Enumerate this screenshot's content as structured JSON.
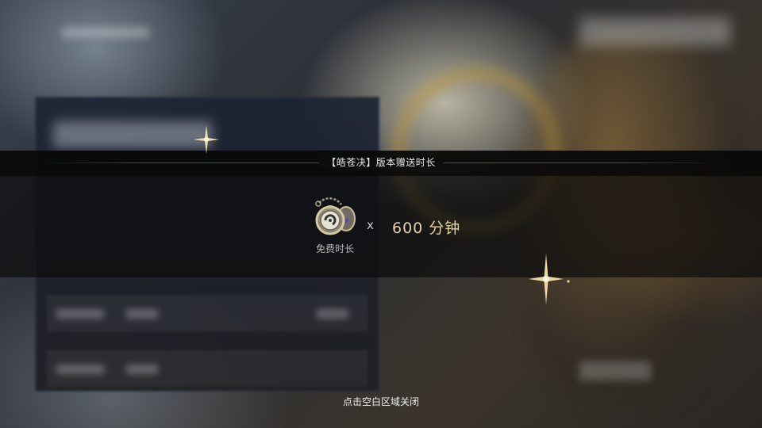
{
  "popup": {
    "title": "【皓苍决】版本赠送时长",
    "reward": {
      "icon": "pocket-watch-icon",
      "label": "免费时长",
      "multiplier": "x",
      "amount": "600 分钟"
    }
  },
  "close_hint": "点击空白区域关闭",
  "colors": {
    "accent_gold": "#e4d1a8",
    "overlay": "#0c0c0c",
    "text_light": "#e8e8e8"
  }
}
